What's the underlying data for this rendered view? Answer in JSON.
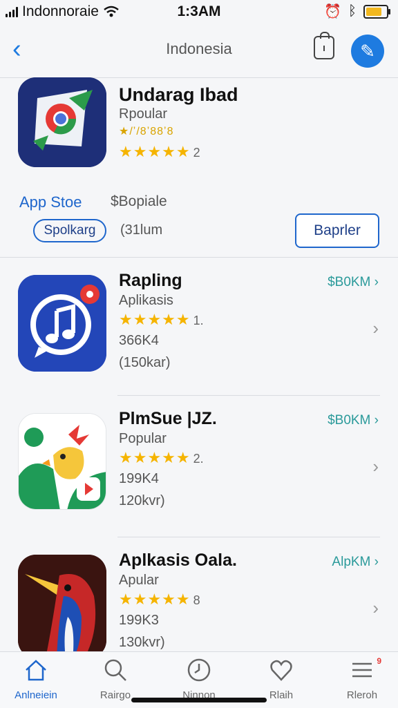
{
  "status_bar": {
    "carrier": "Indonnoraie",
    "time": "1:3AM",
    "icons": [
      "signal-icon",
      "wifi-icon",
      "alarm-icon",
      "bluetooth-icon",
      "battery-icon"
    ]
  },
  "nav": {
    "title": "Indonesia",
    "back_glyph": "‹",
    "icons": [
      "back-chevron-icon",
      "shopping-bag-icon",
      "profile-icon"
    ]
  },
  "featured": {
    "name": "Undarag Ibad",
    "category": "Rpoular",
    "subtitle": "★/ʼ/8ʼ88ʼ8",
    "stars": "★★★★★",
    "rating": "2",
    "store_label": "App Stoe",
    "price": "$Bopiale",
    "pill_label": "Spolkarg",
    "size_note": "(31lum",
    "button_label": "Baprler"
  },
  "apps": [
    {
      "name": "Rapling",
      "category": "Aplikasis",
      "stars": "★★★★★",
      "rating": "1.",
      "count": "366K4",
      "size": "(150kar)",
      "price": "$B0KM ›",
      "chevron": "›"
    },
    {
      "name": "PlmSue |JZ.",
      "category": "Popular",
      "stars": "★★★★★",
      "rating": "2.",
      "count": "199K4",
      "size": "120kvr)",
      "price": "$B0KM ›",
      "chevron": "›"
    },
    {
      "name": "Aplkasis Oala.",
      "category": "Apular",
      "stars": "★★★★★",
      "rating": "8",
      "count": "199K3",
      "size": "130kvr)",
      "price": "AlpKM ›",
      "chevron": "›"
    }
  ],
  "tabs": [
    {
      "label": "Anlneiein",
      "icon": "home-icon"
    },
    {
      "label": "Rairgo",
      "icon": "search-icon"
    },
    {
      "label": "Ninnon",
      "icon": "clock-icon"
    },
    {
      "label": "Rlaih",
      "icon": "heart-icon"
    },
    {
      "label": "Rleroh",
      "icon": "menu-icon",
      "badge": "9"
    }
  ],
  "colors": {
    "accent": "#1e66cc",
    "price": "#2a9a9a",
    "star": "#f5b400"
  }
}
